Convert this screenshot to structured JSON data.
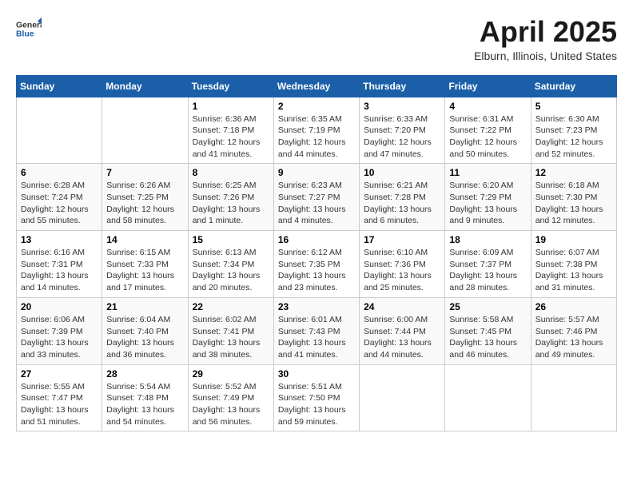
{
  "header": {
    "logo_general": "General",
    "logo_blue": "Blue",
    "month_title": "April 2025",
    "location": "Elburn, Illinois, United States"
  },
  "weekdays": [
    "Sunday",
    "Monday",
    "Tuesday",
    "Wednesday",
    "Thursday",
    "Friday",
    "Saturday"
  ],
  "weeks": [
    [
      {
        "day": "",
        "sunrise": "",
        "sunset": "",
        "daylight": ""
      },
      {
        "day": "",
        "sunrise": "",
        "sunset": "",
        "daylight": ""
      },
      {
        "day": "1",
        "sunrise": "Sunrise: 6:36 AM",
        "sunset": "Sunset: 7:18 PM",
        "daylight": "Daylight: 12 hours and 41 minutes."
      },
      {
        "day": "2",
        "sunrise": "Sunrise: 6:35 AM",
        "sunset": "Sunset: 7:19 PM",
        "daylight": "Daylight: 12 hours and 44 minutes."
      },
      {
        "day": "3",
        "sunrise": "Sunrise: 6:33 AM",
        "sunset": "Sunset: 7:20 PM",
        "daylight": "Daylight: 12 hours and 47 minutes."
      },
      {
        "day": "4",
        "sunrise": "Sunrise: 6:31 AM",
        "sunset": "Sunset: 7:22 PM",
        "daylight": "Daylight: 12 hours and 50 minutes."
      },
      {
        "day": "5",
        "sunrise": "Sunrise: 6:30 AM",
        "sunset": "Sunset: 7:23 PM",
        "daylight": "Daylight: 12 hours and 52 minutes."
      }
    ],
    [
      {
        "day": "6",
        "sunrise": "Sunrise: 6:28 AM",
        "sunset": "Sunset: 7:24 PM",
        "daylight": "Daylight: 12 hours and 55 minutes."
      },
      {
        "day": "7",
        "sunrise": "Sunrise: 6:26 AM",
        "sunset": "Sunset: 7:25 PM",
        "daylight": "Daylight: 12 hours and 58 minutes."
      },
      {
        "day": "8",
        "sunrise": "Sunrise: 6:25 AM",
        "sunset": "Sunset: 7:26 PM",
        "daylight": "Daylight: 13 hours and 1 minute."
      },
      {
        "day": "9",
        "sunrise": "Sunrise: 6:23 AM",
        "sunset": "Sunset: 7:27 PM",
        "daylight": "Daylight: 13 hours and 4 minutes."
      },
      {
        "day": "10",
        "sunrise": "Sunrise: 6:21 AM",
        "sunset": "Sunset: 7:28 PM",
        "daylight": "Daylight: 13 hours and 6 minutes."
      },
      {
        "day": "11",
        "sunrise": "Sunrise: 6:20 AM",
        "sunset": "Sunset: 7:29 PM",
        "daylight": "Daylight: 13 hours and 9 minutes."
      },
      {
        "day": "12",
        "sunrise": "Sunrise: 6:18 AM",
        "sunset": "Sunset: 7:30 PM",
        "daylight": "Daylight: 13 hours and 12 minutes."
      }
    ],
    [
      {
        "day": "13",
        "sunrise": "Sunrise: 6:16 AM",
        "sunset": "Sunset: 7:31 PM",
        "daylight": "Daylight: 13 hours and 14 minutes."
      },
      {
        "day": "14",
        "sunrise": "Sunrise: 6:15 AM",
        "sunset": "Sunset: 7:33 PM",
        "daylight": "Daylight: 13 hours and 17 minutes."
      },
      {
        "day": "15",
        "sunrise": "Sunrise: 6:13 AM",
        "sunset": "Sunset: 7:34 PM",
        "daylight": "Daylight: 13 hours and 20 minutes."
      },
      {
        "day": "16",
        "sunrise": "Sunrise: 6:12 AM",
        "sunset": "Sunset: 7:35 PM",
        "daylight": "Daylight: 13 hours and 23 minutes."
      },
      {
        "day": "17",
        "sunrise": "Sunrise: 6:10 AM",
        "sunset": "Sunset: 7:36 PM",
        "daylight": "Daylight: 13 hours and 25 minutes."
      },
      {
        "day": "18",
        "sunrise": "Sunrise: 6:09 AM",
        "sunset": "Sunset: 7:37 PM",
        "daylight": "Daylight: 13 hours and 28 minutes."
      },
      {
        "day": "19",
        "sunrise": "Sunrise: 6:07 AM",
        "sunset": "Sunset: 7:38 PM",
        "daylight": "Daylight: 13 hours and 31 minutes."
      }
    ],
    [
      {
        "day": "20",
        "sunrise": "Sunrise: 6:06 AM",
        "sunset": "Sunset: 7:39 PM",
        "daylight": "Daylight: 13 hours and 33 minutes."
      },
      {
        "day": "21",
        "sunrise": "Sunrise: 6:04 AM",
        "sunset": "Sunset: 7:40 PM",
        "daylight": "Daylight: 13 hours and 36 minutes."
      },
      {
        "day": "22",
        "sunrise": "Sunrise: 6:02 AM",
        "sunset": "Sunset: 7:41 PM",
        "daylight": "Daylight: 13 hours and 38 minutes."
      },
      {
        "day": "23",
        "sunrise": "Sunrise: 6:01 AM",
        "sunset": "Sunset: 7:43 PM",
        "daylight": "Daylight: 13 hours and 41 minutes."
      },
      {
        "day": "24",
        "sunrise": "Sunrise: 6:00 AM",
        "sunset": "Sunset: 7:44 PM",
        "daylight": "Daylight: 13 hours and 44 minutes."
      },
      {
        "day": "25",
        "sunrise": "Sunrise: 5:58 AM",
        "sunset": "Sunset: 7:45 PM",
        "daylight": "Daylight: 13 hours and 46 minutes."
      },
      {
        "day": "26",
        "sunrise": "Sunrise: 5:57 AM",
        "sunset": "Sunset: 7:46 PM",
        "daylight": "Daylight: 13 hours and 49 minutes."
      }
    ],
    [
      {
        "day": "27",
        "sunrise": "Sunrise: 5:55 AM",
        "sunset": "Sunset: 7:47 PM",
        "daylight": "Daylight: 13 hours and 51 minutes."
      },
      {
        "day": "28",
        "sunrise": "Sunrise: 5:54 AM",
        "sunset": "Sunset: 7:48 PM",
        "daylight": "Daylight: 13 hours and 54 minutes."
      },
      {
        "day": "29",
        "sunrise": "Sunrise: 5:52 AM",
        "sunset": "Sunset: 7:49 PM",
        "daylight": "Daylight: 13 hours and 56 minutes."
      },
      {
        "day": "30",
        "sunrise": "Sunrise: 5:51 AM",
        "sunset": "Sunset: 7:50 PM",
        "daylight": "Daylight: 13 hours and 59 minutes."
      },
      {
        "day": "",
        "sunrise": "",
        "sunset": "",
        "daylight": ""
      },
      {
        "day": "",
        "sunrise": "",
        "sunset": "",
        "daylight": ""
      },
      {
        "day": "",
        "sunrise": "",
        "sunset": "",
        "daylight": ""
      }
    ]
  ]
}
